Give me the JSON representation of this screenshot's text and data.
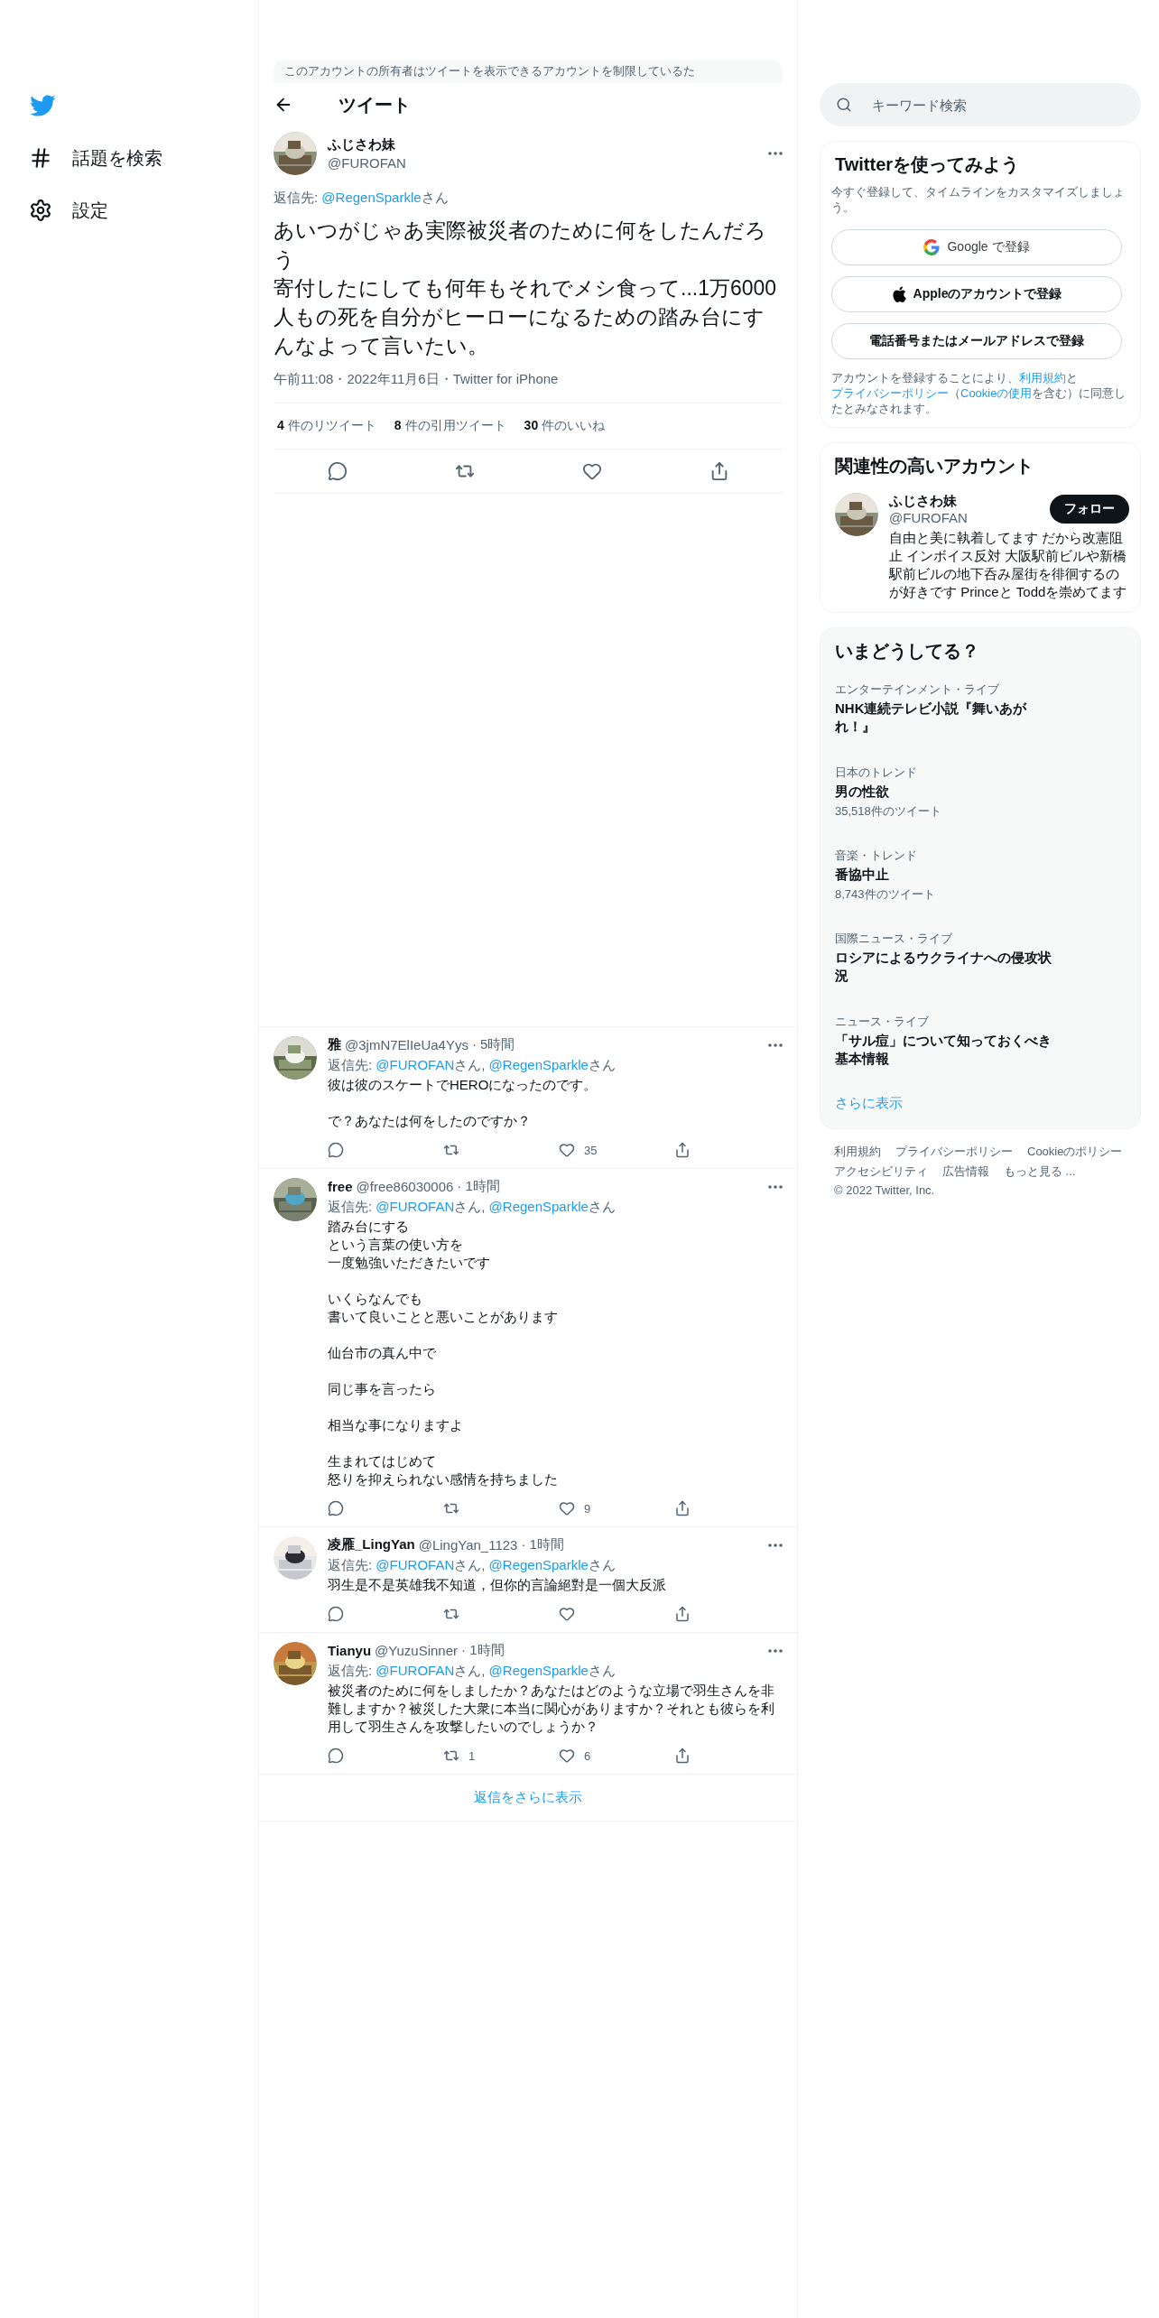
{
  "sidebar": {
    "items": [
      {
        "kind": "hashtag",
        "label": "話題を検索"
      },
      {
        "kind": "settings",
        "label": "設定"
      }
    ]
  },
  "notice": "このアカウントの所有者はツイートを表示できるアカウントを制限しているた",
  "header": {
    "title": "ツイート"
  },
  "tweet": {
    "name": "ふじさわ妹",
    "handle": "@FUROFAN",
    "reply_to": [
      {
        "kind": "plain",
        "text": "返信先: "
      },
      {
        "kind": "link",
        "text": "@RegenSparkle"
      },
      {
        "kind": "plain",
        "text": "さん"
      }
    ],
    "paragraphs": [
      [
        "あいつがじゃあ実際被災者のために何をしたんだろう",
        "寄付したにしても何年もそれでメシ食って...1万6000人もの死を自分がヒーローになるための踏み台にすんなよって言いたい。"
      ]
    ],
    "meta": "午前11:08・2022年11月6日・Twitter for iPhone",
    "stats": [
      {
        "count": "4",
        "label": "件のリツイート"
      },
      {
        "count": "8",
        "label": "件の引用ツイート"
      },
      {
        "count": "30",
        "label": "件のいいね"
      }
    ],
    "actions": [
      {
        "kind": "reply"
      },
      {
        "kind": "retweet"
      },
      {
        "kind": "like"
      },
      {
        "kind": "share"
      }
    ]
  },
  "replies": [
    {
      "name": "雅",
      "handle": "@3jmN7ElIeUa4Yys",
      "time": "· 5時間",
      "reply_to": [
        {
          "kind": "plain",
          "text": "返信先: "
        },
        {
          "kind": "link",
          "text": "@FUROFAN"
        },
        {
          "kind": "plain",
          "text": "さん, "
        },
        {
          "kind": "link",
          "text": "@RegenSparkle"
        },
        {
          "kind": "plain",
          "text": "さん"
        }
      ],
      "paragraphs": [
        [
          "彼は彼のスケートでHEROになったのです。"
        ],
        [
          "で？あなたは何をしたのですか？"
        ]
      ],
      "actions": [
        {
          "kind": "reply"
        },
        {
          "kind": "retweet"
        },
        {
          "kind": "like",
          "count": "35"
        },
        {
          "kind": "share"
        }
      ]
    },
    {
      "name": "free",
      "handle": "@free86030006",
      "time": "· 1時間",
      "reply_to": [
        {
          "kind": "plain",
          "text": "返信先: "
        },
        {
          "kind": "link",
          "text": "@FUROFAN"
        },
        {
          "kind": "plain",
          "text": "さん, "
        },
        {
          "kind": "link",
          "text": "@RegenSparkle"
        },
        {
          "kind": "plain",
          "text": "さん"
        }
      ],
      "paragraphs": [
        [
          "踏み台にする",
          "という言葉の使い方を",
          "一度勉強いただきたいです"
        ],
        [
          "いくらなんでも",
          "書いて良いことと悪いことがあります"
        ],
        [
          "仙台市の真ん中で"
        ],
        [
          "同じ事を言ったら"
        ],
        [
          "相当な事になりますよ"
        ],
        [
          "生まれてはじめて",
          "怒りを抑えられない感情を持ちました"
        ]
      ],
      "actions": [
        {
          "kind": "reply"
        },
        {
          "kind": "retweet"
        },
        {
          "kind": "like",
          "count": "9"
        },
        {
          "kind": "share"
        }
      ]
    },
    {
      "name": "凌雁_LingYan",
      "handle": "@LingYan_1123",
      "time": "· 1時間",
      "reply_to": [
        {
          "kind": "plain",
          "text": "返信先: "
        },
        {
          "kind": "link",
          "text": "@FUROFAN"
        },
        {
          "kind": "plain",
          "text": "さん, "
        },
        {
          "kind": "link",
          "text": "@RegenSparkle"
        },
        {
          "kind": "plain",
          "text": "さん"
        }
      ],
      "paragraphs": [
        [
          "羽生是不是英雄我不知道，但你的言論絕對是一個大反派"
        ]
      ],
      "actions": [
        {
          "kind": "reply"
        },
        {
          "kind": "retweet"
        },
        {
          "kind": "like"
        },
        {
          "kind": "share"
        }
      ]
    },
    {
      "name": "Tianyu",
      "handle": "@YuzuSinner",
      "time": "· 1時間",
      "reply_to": [
        {
          "kind": "plain",
          "text": "返信先: "
        },
        {
          "kind": "link",
          "text": "@FUROFAN"
        },
        {
          "kind": "plain",
          "text": "さん, "
        },
        {
          "kind": "link",
          "text": "@RegenSparkle"
        },
        {
          "kind": "plain",
          "text": "さん"
        }
      ],
      "paragraphs": [
        [
          "被災者のために何をしましたか？あなたはどのような立場で羽生さんを非難しますか？被災した大衆に本当に関心がありますか？それとも彼らを利用して羽生さんを攻撃したいのでしょうか？"
        ]
      ],
      "actions": [
        {
          "kind": "reply"
        },
        {
          "kind": "retweet",
          "count": "1"
        },
        {
          "kind": "like",
          "count": "6"
        },
        {
          "kind": "share"
        }
      ]
    }
  ],
  "show_more_replies": "返信をさらに表示",
  "search": {
    "placeholder": "キーワード検索"
  },
  "signup": {
    "title": "Twitterを使ってみよう",
    "subtitle": "今すぐ登録して、タイムラインをカスタマイズしましょう。",
    "buttons": [
      {
        "kind": "google",
        "label": "Google で登録"
      },
      {
        "kind": "apple",
        "label": "Appleのアカウントで登録"
      },
      {
        "kind": "plain",
        "label": "電話番号またはメールアドレスで登録"
      }
    ],
    "legal": [
      {
        "kind": "plain",
        "text": "アカウントを登録することにより、"
      },
      {
        "kind": "link",
        "text": "利用規約"
      },
      {
        "kind": "plain",
        "text": "と"
      },
      {
        "kind": "link",
        "text": "プライバシーポリシー"
      },
      {
        "kind": "plain",
        "text": "（"
      },
      {
        "kind": "link",
        "text": "Cookieの使用"
      },
      {
        "kind": "plain",
        "text": "を含む）に同意したとみなされます。"
      }
    ]
  },
  "related": {
    "title": "関連性の高いアカウント",
    "name": "ふじさわ妹",
    "handle": "@FUROFAN",
    "follow": "フォロー",
    "bio": "自由と美に執着してます だから改憲阻止 インボイス反対 大阪駅前ビルや新橋駅前ビルの地下呑み屋街を徘徊するのが好きです Princeと Toddを崇めてます"
  },
  "trends": {
    "title": "いまどうしてる？",
    "items": [
      {
        "context": "エンターテインメント・ライブ",
        "title": "NHK連続テレビ小説『舞いあがれ！』"
      },
      {
        "context": "日本のトレンド",
        "title": "男の性欲",
        "count": "35,518件のツイート"
      },
      {
        "context": "音楽・トレンド",
        "title": "番協中止",
        "count": "8,743件のツイート"
      },
      {
        "context": "国際ニュース・ライブ",
        "title": "ロシアによるウクライナへの侵攻状況"
      },
      {
        "context": "ニュース・ライブ",
        "title": "「サル痘」について知っておくべき基本情報"
      }
    ],
    "show_more": "さらに表示"
  },
  "footer": {
    "links": [
      "利用規約",
      "プライバシーポリシー",
      "Cookieのポリシー",
      "アクセシビリティ",
      "広告情報",
      "もっと見る ..."
    ],
    "copyright": "© 2022 Twitter, Inc."
  }
}
